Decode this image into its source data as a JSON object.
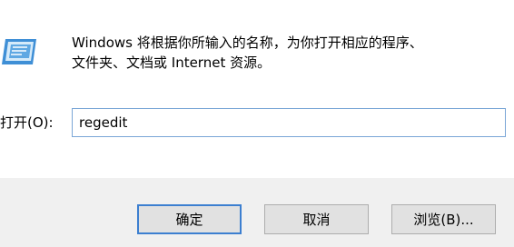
{
  "dialog": {
    "description_line1": "Windows 将根据你所输入的名称，为你打开相应的程序、",
    "description_line2": "文件夹、文档或 Internet 资源。",
    "icon": "run-icon"
  },
  "command": {
    "label": "打开(O):",
    "value": "regedit"
  },
  "buttons": {
    "ok": "确定",
    "cancel": "取消",
    "browse": "浏览(B)..."
  },
  "colors": {
    "focus_border": "#3c7fd0",
    "input_border": "#7aa6d6",
    "button_bar": "#f0f0f0",
    "button_face": "#e1e1e1"
  }
}
